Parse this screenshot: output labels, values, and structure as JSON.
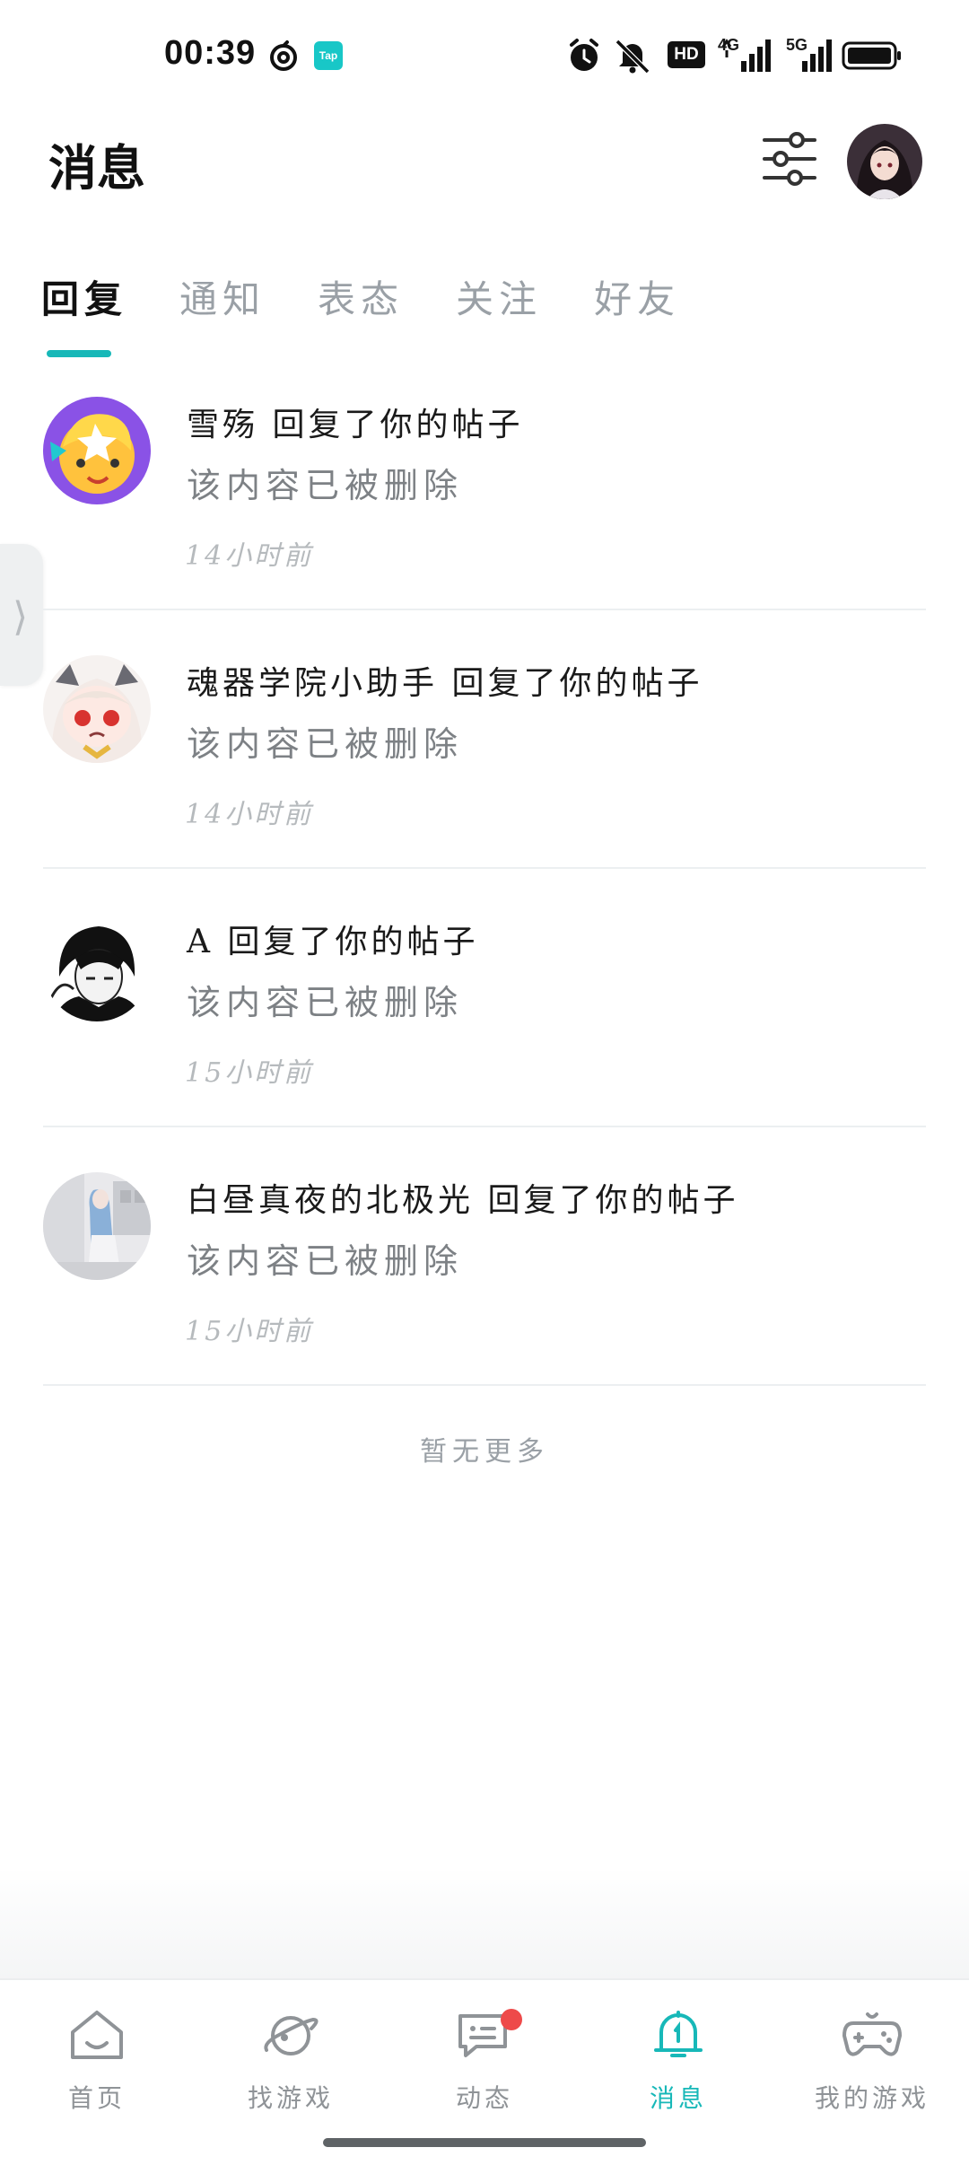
{
  "status_bar": {
    "time": "00:39",
    "network": "4G",
    "network2": "5G",
    "hd_label": "HD"
  },
  "header": {
    "title": "消息"
  },
  "tabs": [
    {
      "label": "回复",
      "active": true
    },
    {
      "label": "通知",
      "active": false
    },
    {
      "label": "表态",
      "active": false
    },
    {
      "label": "关注",
      "active": false
    },
    {
      "label": "好友",
      "active": false
    }
  ],
  "messages": [
    {
      "user": "雪殇",
      "action": "回复了你的帖子",
      "content": "该内容已被删除",
      "time": "14小时前",
      "avatar_icon": "avatar-cartoon-yellow"
    },
    {
      "user": "魂器学院小助手",
      "action": "回复了你的帖子",
      "content": "该内容已被删除",
      "time": "14小时前",
      "avatar_icon": "avatar-anime-girl"
    },
    {
      "user": "A",
      "action": "回复了你的帖子",
      "content": "该内容已被删除",
      "time": "15小时前",
      "avatar_icon": "avatar-anime-boy"
    },
    {
      "user": "白昼真夜的北极光",
      "action": "回复了你的帖子",
      "content": "该内容已被删除",
      "time": "15小时前",
      "avatar_icon": "avatar-photo"
    }
  ],
  "footer_text": "暂无更多",
  "bottom_nav": [
    {
      "label": "首页",
      "icon": "home-icon",
      "active": false
    },
    {
      "label": "找游戏",
      "icon": "planet-icon",
      "active": false
    },
    {
      "label": "动态",
      "icon": "chat-icon",
      "active": false,
      "badge": true
    },
    {
      "label": "消息",
      "icon": "bell-icon",
      "active": true
    },
    {
      "label": "我的游戏",
      "icon": "gamepad-icon",
      "active": false
    }
  ],
  "colors": {
    "accent": "#17b8b8",
    "badge": "#ee4a4a",
    "muted_text": "#7d8185"
  }
}
